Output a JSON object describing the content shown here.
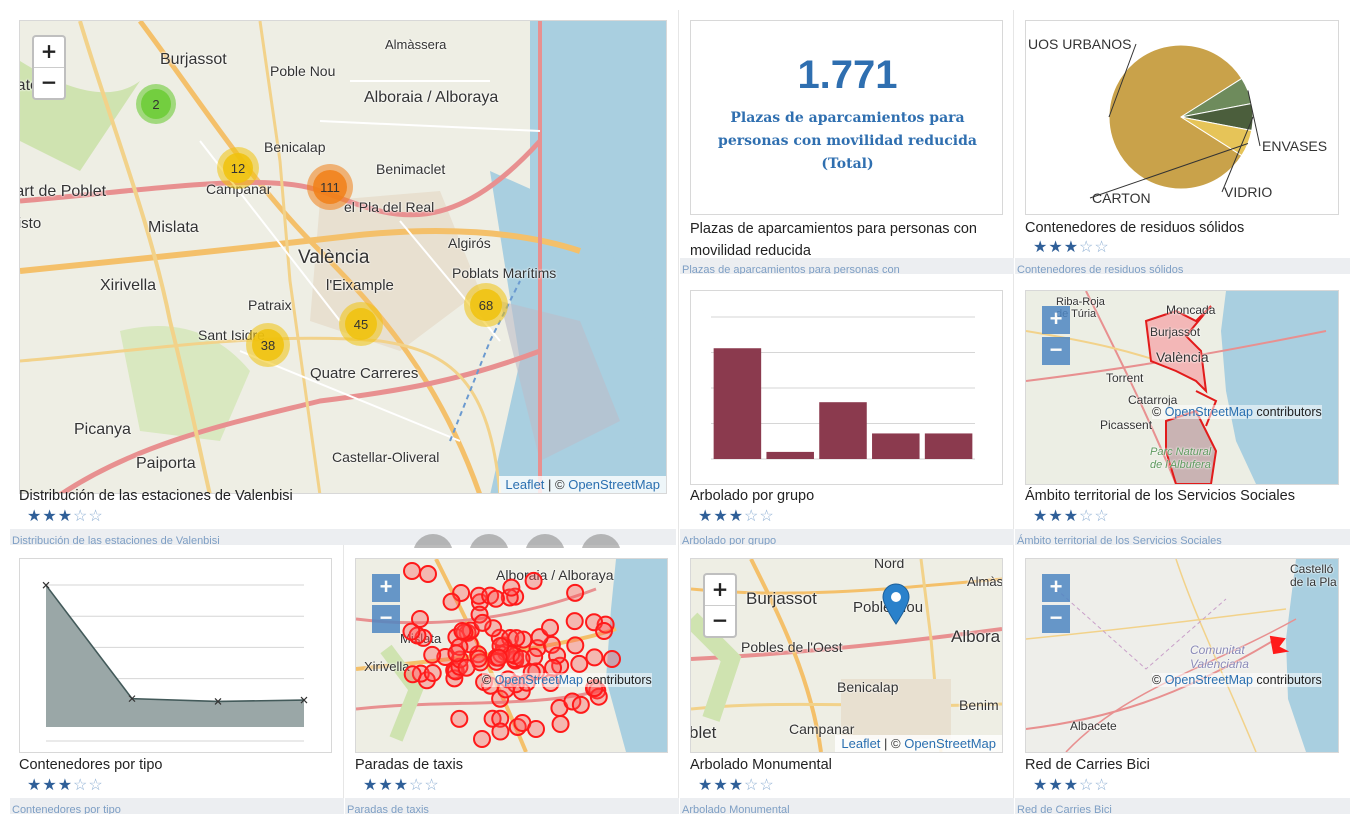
{
  "cards": [
    {
      "title": "Distribución de las estaciones de Valenbisi",
      "strip": "Distribución de las estaciones de Valenbisi"
    },
    {
      "title": "Plazas de aparcamientos para personas con movilidad reducida",
      "strip": "Plazas de aparcamientos para personas con"
    },
    {
      "title": "Contenedores de residuos sólidos",
      "strip": "Contenedores de residuos sólidos"
    },
    {
      "title": "Arbolado por grupo",
      "strip": "Arbolado por grupo"
    },
    {
      "title": "Ámbito territorial de los Servicios Sociales",
      "strip": "Ámbito territorial de los Servicios Sociales"
    },
    {
      "title": "Contenedores por tipo",
      "strip": "Contenedores por tipo"
    },
    {
      "title": "Paradas de taxis",
      "strip": "Paradas de taxis"
    },
    {
      "title": "Arbolado Monumental",
      "strip": "Arbolado Monumental"
    },
    {
      "title": "Red de Carries Bici",
      "strip": "Red de Carries Bici"
    }
  ],
  "rating": {
    "filled": "★★★",
    "empty": "☆☆",
    "value": 3,
    "max": 5
  },
  "kpi": {
    "value": "1.771",
    "label": "Plazas de aparcamientos para personas con movilidad reducida (Total)"
  },
  "map_main": {
    "zoom_in": "+",
    "zoom_out": "−",
    "attrib_leaflet": "Leaflet",
    "attrib_sep": " | © ",
    "attrib_osm": "OpenStreetMap",
    "clusters": [
      "2",
      "12",
      "111",
      "45",
      "68",
      "38"
    ],
    "places": [
      "Burjassot",
      "Poble Nou",
      "Almàssera",
      "Alboraia / Alboraya",
      "Paterna",
      "Benicalap",
      "Benimaclet",
      "Campanar",
      "Quart de Poblet",
      "el Pla del Real",
      "Mislata",
      "València",
      "Algirós",
      "Poblats Marítims",
      "Xirivella",
      "l'Eixample",
      "Patraix",
      "Sant Isidre",
      "Quatre Carreres",
      "Picanya",
      "Paiporta",
      "Castellar-Oliveral",
      "Cristo",
      "Nord",
      "Pobles de l'Oest"
    ]
  },
  "map_social": {
    "zoom_in": "+",
    "zoom_out": "−",
    "osm": "OpenStreetMap",
    "contrib": "contributors",
    "places": [
      "Riba-Roja de Túria",
      "Moncada",
      "Burjassot",
      "València",
      "Torrent",
      "Catarroja",
      "Picassent",
      "Parc Natural de l'Albufera"
    ]
  },
  "map_taxi": {
    "zoom_in": "+",
    "zoom_out": "−",
    "osm": "OpenStreetMap",
    "contrib": "contributors",
    "places": [
      "Alboraia / Alboraya",
      "Mislata",
      "Xirivella"
    ]
  },
  "map_monument": {
    "zoom_in": "+",
    "zoom_out": "−",
    "attrib_leaflet": "Leaflet",
    "attrib_sep": " | © ",
    "attrib_osm": "OpenStreetMap",
    "places": [
      "Nord",
      "Burjassot",
      "Poble Nou",
      "Almàss",
      "Pobles de l'Oest",
      "Albora",
      "Benicalap",
      "Benim",
      "Campanar",
      "blet"
    ]
  },
  "map_bici": {
    "zoom_in": "+",
    "zoom_out": "−",
    "osm": "OpenStreetMap",
    "contrib": "contributors",
    "places": [
      "Castelló de la Pla",
      "Comunitat Valenciana",
      "Albacete"
    ]
  },
  "colors": {
    "accent": "#2f6fb0",
    "bar": "#8b3a4e",
    "area": "#9aa7a7",
    "pie_org": "#c9a24a",
    "pie_envases": "#6e8b5c",
    "pie_vidrio": "#4b5e3c",
    "pie_carton": "#e6c458"
  },
  "chart_data": [
    {
      "type": "pie",
      "labels": [
        "UOS URBANOS",
        "ENVASES",
        "VIDRIO",
        "CARTON"
      ],
      "values": [
        82,
        6,
        6,
        6
      ]
    },
    {
      "type": "bar",
      "categories": [
        "",
        "",
        "",
        "",
        ""
      ],
      "values": [
        78,
        5,
        40,
        18,
        18
      ],
      "ylim": [
        0,
        100
      ],
      "grid": true
    },
    {
      "type": "line",
      "x": [
        1,
        2,
        3,
        4
      ],
      "values": [
        100,
        20,
        18,
        19
      ],
      "ylim": [
        0,
        110
      ],
      "grid": true,
      "area": true
    }
  ]
}
